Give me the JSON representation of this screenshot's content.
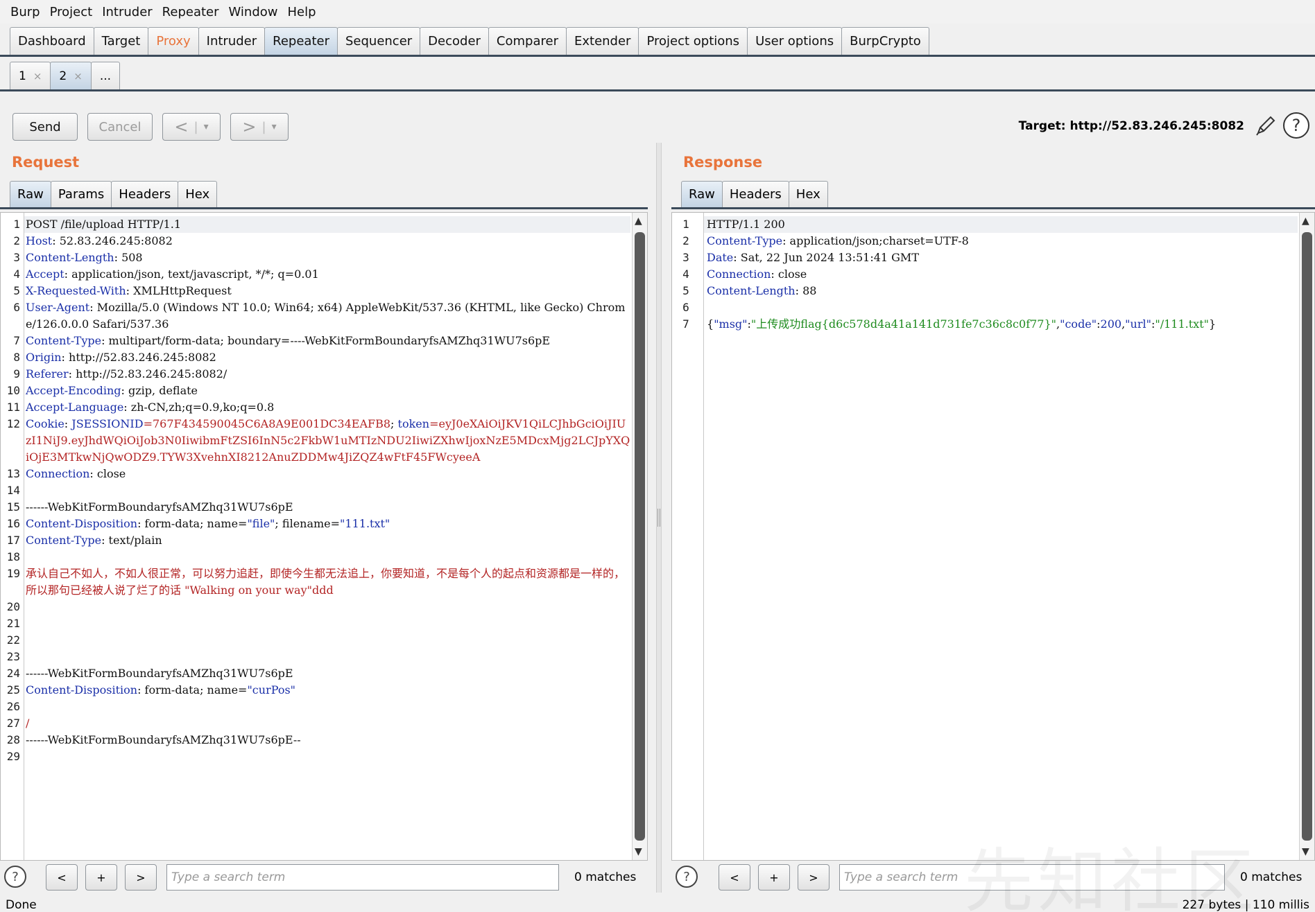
{
  "menu": [
    "Burp",
    "Project",
    "Intruder",
    "Repeater",
    "Window",
    "Help"
  ],
  "main_tabs": [
    {
      "label": "Dashboard",
      "state": "normal"
    },
    {
      "label": "Target",
      "state": "normal"
    },
    {
      "label": "Proxy",
      "state": "highlight"
    },
    {
      "label": "Intruder",
      "state": "normal"
    },
    {
      "label": "Repeater",
      "state": "active"
    },
    {
      "label": "Sequencer",
      "state": "normal"
    },
    {
      "label": "Decoder",
      "state": "normal"
    },
    {
      "label": "Comparer",
      "state": "normal"
    },
    {
      "label": "Extender",
      "state": "normal"
    },
    {
      "label": "Project options",
      "state": "normal"
    },
    {
      "label": "User options",
      "state": "normal"
    },
    {
      "label": "BurpCrypto",
      "state": "normal"
    }
  ],
  "repeater_tabs": [
    {
      "label": "1",
      "close": "×",
      "active": false
    },
    {
      "label": "2",
      "close": "×",
      "active": true
    },
    {
      "label": "...",
      "close": "",
      "active": false
    }
  ],
  "toolbar": {
    "send": "Send",
    "cancel": "Cancel",
    "back": "<",
    "forward": ">",
    "dropdown": "▾",
    "target": "Target: http://52.83.246.245:8082"
  },
  "request": {
    "title": "Request",
    "tabs": [
      "Raw",
      "Params",
      "Headers",
      "Hex"
    ],
    "lines": [
      {
        "n": "1",
        "parts": [
          {
            "t": "POST /file/upload HTTP/1.1",
            "c": "val"
          }
        ]
      },
      {
        "n": "2",
        "parts": [
          {
            "t": "Host",
            "c": "key"
          },
          {
            "t": ": 52.83.246.245:8082",
            "c": "val"
          }
        ]
      },
      {
        "n": "3",
        "parts": [
          {
            "t": "Content-Length",
            "c": "key"
          },
          {
            "t": ": 508",
            "c": "val"
          }
        ]
      },
      {
        "n": "4",
        "parts": [
          {
            "t": "Accept",
            "c": "key"
          },
          {
            "t": ": application/json, text/javascript, */*; q=0.01",
            "c": "val"
          }
        ]
      },
      {
        "n": "5",
        "parts": [
          {
            "t": "X-Requested-With",
            "c": "key"
          },
          {
            "t": ": XMLHttpRequest",
            "c": "val"
          }
        ]
      },
      {
        "n": "6",
        "parts": [
          {
            "t": "User-Agent",
            "c": "key"
          },
          {
            "t": ": Mozilla/5.0 (Windows NT 10.0; Win64; x64) AppleWebKit/537.36 (KHTML, like Gecko) Chrome/126.0.0.0 Safari/537.36",
            "c": "val"
          }
        ]
      },
      {
        "n": "7",
        "parts": [
          {
            "t": "Content-Type",
            "c": "key"
          },
          {
            "t": ": multipart/form-data; boundary=----WebKitFormBoundaryfsAMZhq31WU7s6pE",
            "c": "val"
          }
        ]
      },
      {
        "n": "8",
        "parts": [
          {
            "t": "Origin",
            "c": "key"
          },
          {
            "t": ": http://52.83.246.245:8082",
            "c": "val"
          }
        ]
      },
      {
        "n": "9",
        "parts": [
          {
            "t": "Referer",
            "c": "key"
          },
          {
            "t": ": http://52.83.246.245:8082/",
            "c": "val"
          }
        ]
      },
      {
        "n": "10",
        "parts": [
          {
            "t": "Accept-Encoding",
            "c": "key"
          },
          {
            "t": ": gzip, deflate",
            "c": "val"
          }
        ]
      },
      {
        "n": "11",
        "parts": [
          {
            "t": "Accept-Language",
            "c": "key"
          },
          {
            "t": ": zh-CN,zh;q=0.9,ko;q=0.8",
            "c": "val"
          }
        ]
      },
      {
        "n": "12",
        "parts": [
          {
            "t": "Cookie",
            "c": "key"
          },
          {
            "t": ": ",
            "c": "val"
          },
          {
            "t": "JSESSIONID",
            "c": "blue"
          },
          {
            "t": "=767F434590045C6A8A9E001DC34EAFB8",
            "c": "red"
          },
          {
            "t": "; ",
            "c": "val"
          },
          {
            "t": "token",
            "c": "blue"
          },
          {
            "t": "=eyJ0eXAiOiJKV1QiLCJhbGciOiJIUzI1NiJ9.eyJhdWQiOiJob3N0IiwibmFtZSI6InN5c2FkbW1uMTIzNDU2IiwiZXhwIjoxNzE5MDcxMjg2LCJpYXQiOjE3MTkwNjQwODZ9.TYW3XvehnXI8212AnuZDDMw4JiZQZ4wFtF45FWcyeeA",
            "c": "red"
          }
        ]
      },
      {
        "n": "13",
        "parts": [
          {
            "t": "Connection",
            "c": "key"
          },
          {
            "t": ": close",
            "c": "val"
          }
        ]
      },
      {
        "n": "14",
        "parts": []
      },
      {
        "n": "15",
        "parts": [
          {
            "t": "------WebKitFormBoundaryfsAMZhq31WU7s6pE",
            "c": "val"
          }
        ]
      },
      {
        "n": "16",
        "parts": [
          {
            "t": "Content-Disposition",
            "c": "key"
          },
          {
            "t": ": form-data; name=",
            "c": "val"
          },
          {
            "t": "\"file\"",
            "c": "blue"
          },
          {
            "t": "; filename=",
            "c": "val"
          },
          {
            "t": "\"111.txt\"",
            "c": "blue"
          }
        ]
      },
      {
        "n": "17",
        "parts": [
          {
            "t": "Content-Type",
            "c": "key"
          },
          {
            "t": ": text/plain",
            "c": "val"
          }
        ]
      },
      {
        "n": "18",
        "parts": []
      },
      {
        "n": "19",
        "parts": [
          {
            "t": "承认自己不如人，不如人很正常，可以努力追赶，即使今生都无法追上，你要知道，不是每个人的起点和资源都是一样的，所以那句已经被人说了烂了的话 \"Walking on your way\"ddd",
            "c": "red"
          }
        ]
      },
      {
        "n": "20",
        "parts": []
      },
      {
        "n": "21",
        "parts": []
      },
      {
        "n": "22",
        "parts": []
      },
      {
        "n": "23",
        "parts": []
      },
      {
        "n": "24",
        "parts": [
          {
            "t": "------WebKitFormBoundaryfsAMZhq31WU7s6pE",
            "c": "val"
          }
        ]
      },
      {
        "n": "25",
        "parts": [
          {
            "t": "Content-Disposition",
            "c": "key"
          },
          {
            "t": ": form-data; name=",
            "c": "val"
          },
          {
            "t": "\"curPos\"",
            "c": "blue"
          }
        ]
      },
      {
        "n": "26",
        "parts": []
      },
      {
        "n": "27",
        "parts": [
          {
            "t": "/",
            "c": "red"
          }
        ]
      },
      {
        "n": "28",
        "parts": [
          {
            "t": "------WebKitFormBoundaryfsAMZhq31WU7s6pE--",
            "c": "val"
          }
        ]
      },
      {
        "n": "29",
        "parts": []
      }
    ],
    "search_placeholder": "Type a search term",
    "matches": "0 matches"
  },
  "response": {
    "title": "Response",
    "tabs": [
      "Raw",
      "Headers",
      "Hex"
    ],
    "lines": [
      {
        "n": "1",
        "parts": [
          {
            "t": "HTTP/1.1 200",
            "c": "val"
          }
        ]
      },
      {
        "n": "2",
        "parts": [
          {
            "t": "Content-Type",
            "c": "key"
          },
          {
            "t": ": application/json;charset=UTF-8",
            "c": "val"
          }
        ]
      },
      {
        "n": "3",
        "parts": [
          {
            "t": "Date",
            "c": "key"
          },
          {
            "t": ": Sat, 22 Jun 2024 13:51:41 GMT",
            "c": "val"
          }
        ]
      },
      {
        "n": "4",
        "parts": [
          {
            "t": "Connection",
            "c": "key"
          },
          {
            "t": ": close",
            "c": "val"
          }
        ]
      },
      {
        "n": "5",
        "parts": [
          {
            "t": "Content-Length",
            "c": "key"
          },
          {
            "t": ": 88",
            "c": "val"
          }
        ]
      },
      {
        "n": "6",
        "parts": []
      },
      {
        "n": "7",
        "parts": [
          {
            "t": "{",
            "c": "val"
          },
          {
            "t": "\"msg\"",
            "c": "blue"
          },
          {
            "t": ":",
            "c": "val"
          },
          {
            "t": "\"上传成功flag{d6c578d4a41a141d731fe7c36c8c0f77}\"",
            "c": "green"
          },
          {
            "t": ",",
            "c": "val"
          },
          {
            "t": "\"code\"",
            "c": "blue"
          },
          {
            "t": ":",
            "c": "val"
          },
          {
            "t": "200",
            "c": "blue"
          },
          {
            "t": ",",
            "c": "val"
          },
          {
            "t": "\"url\"",
            "c": "blue"
          },
          {
            "t": ":",
            "c": "val"
          },
          {
            "t": "\"/111.txt\"",
            "c": "green"
          },
          {
            "t": "}",
            "c": "val"
          }
        ]
      }
    ],
    "search_placeholder": "Type a search term",
    "matches": "0 matches"
  },
  "status": {
    "left": "Done",
    "right": "227 bytes | 110 millis"
  },
  "icons": {
    "help": "?",
    "prev_match": "<",
    "add_match": "+",
    "next_match": ">",
    "scroll_up": "▲",
    "scroll_down": "▼"
  },
  "watermark": "先知社区",
  "colors": {
    "accent_orange": "#e8743b",
    "header_key": "#1a2fa8",
    "string_red": "#b32424",
    "json_green": "#1e8b1e"
  }
}
